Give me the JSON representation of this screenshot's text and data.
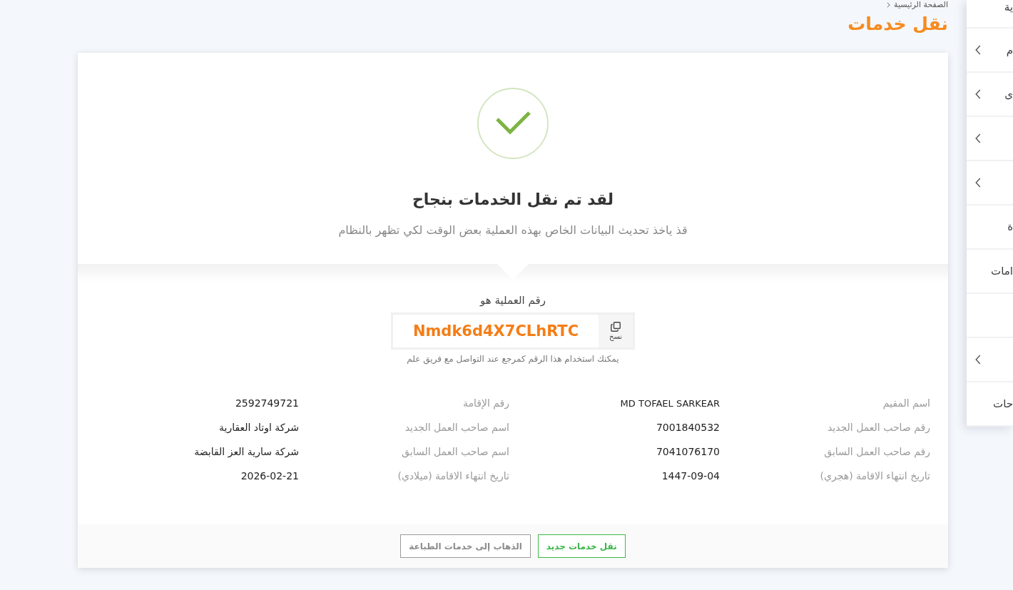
{
  "breadcrumb": {
    "items": [
      {
        "label": "الصفحة الرئيسية"
      }
    ]
  },
  "page_title": "نقل خدمات",
  "sidebar": {
    "items": [
      {
        "label": "ية",
        "has_submenu": false
      },
      {
        "label": "م",
        "has_submenu": true
      },
      {
        "label": "ى",
        "has_submenu": true
      },
      {
        "has_submenu": true
      },
      {
        "has_submenu": true
      },
      {
        "label": "ة",
        "has_submenu": false
      },
      {
        "label": "امات",
        "has_submenu": false
      },
      {
        "has_submenu": false
      },
      {
        "has_submenu": true
      },
      {
        "label": "حات",
        "has_submenu": false
      }
    ]
  },
  "success": {
    "title": "لقد تم نقل الخدمات بنجاح",
    "message": "قذ ياخذ تحديث البيانات الخاص بهذه العملية بعض الوقت لكي تظهر بالنظام"
  },
  "transaction": {
    "label": "رقم العملية هو",
    "code": "Nmdk6d4X7CLhRTC",
    "copy_label": "نسخ",
    "hint": "يمكنك استخدام هذا الرقم كمرجع عند التواصل مع فريق علم"
  },
  "details": [
    {
      "label": "اسم المقيم",
      "value": "MD TOFAEL SARKEAR"
    },
    {
      "label": "رقم الإقامة",
      "value": "2592749721"
    },
    {
      "label": "رقم صاحب العمل الجديد",
      "value": "7001840532"
    },
    {
      "label": "اسم صاحب العمل الجديد",
      "value": "شركة اوتاد العقارية"
    },
    {
      "label": "رقم صاحب العمل السابق",
      "value": "7041076170"
    },
    {
      "label": "اسم صاحب العمل السابق",
      "value": "شركة سارية العز القابضة"
    },
    {
      "label": "تاريخ انتهاء الاقامة (هجري)",
      "value": "1447-09-04"
    },
    {
      "label": "تاريخ انتهاء الاقامة (ميلادي)",
      "value": "2026-02-21"
    }
  ],
  "actions": [
    {
      "label": "نقل خدمات جديد",
      "kind": "primary"
    },
    {
      "label": "الذهاب إلى خدمات الطباعة",
      "kind": "secondary"
    }
  ]
}
